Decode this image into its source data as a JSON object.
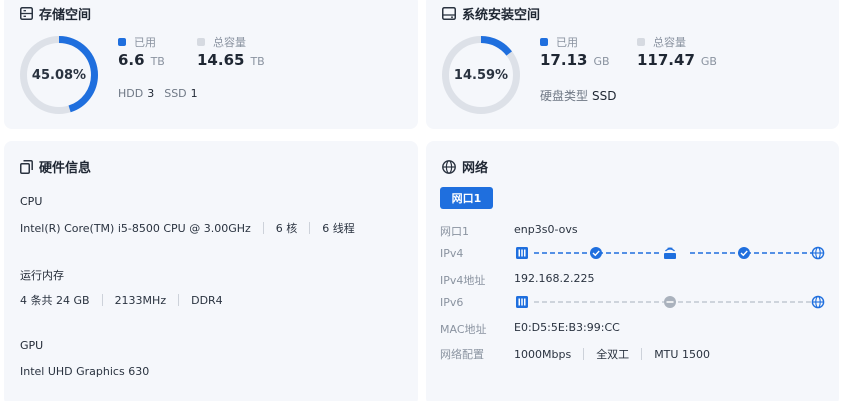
{
  "storage": {
    "title": "存储空间",
    "percent": "45.08%",
    "ratio": 0.4508,
    "used_label": "已用",
    "used_value": "6.6",
    "used_unit": "TB",
    "total_label": "总容量",
    "total_value": "14.65",
    "total_unit": "TB",
    "hdd_label": "HDD",
    "hdd_value": "3",
    "ssd_label": "SSD",
    "ssd_value": "1"
  },
  "system": {
    "title": "系统安装空间",
    "percent": "14.59%",
    "ratio": 0.1459,
    "used_label": "已用",
    "used_value": "17.13",
    "used_unit": "GB",
    "total_label": "总容量",
    "total_value": "117.47",
    "total_unit": "GB",
    "disk_type_label": "硬盘类型",
    "disk_type_value": "SSD"
  },
  "hardware": {
    "title": "硬件信息",
    "cpu_label": "CPU",
    "cpu_model": "Intel(R) Core(TM) i5-8500 CPU @ 3.00GHz",
    "cpu_cores": "6 核",
    "cpu_threads": "6 线程",
    "mem_label": "运行内存",
    "mem_size": "4 条共 24 GB",
    "mem_speed": "2133MHz",
    "mem_type": "DDR4",
    "gpu_label": "GPU",
    "gpu_model": "Intel UHD Graphics 630"
  },
  "network": {
    "title": "网络",
    "tab_label": "网口1",
    "port_label": "网口1",
    "port_value": "enp3s0-ovs",
    "ipv4_label": "IPv4",
    "ipv4_addr_label": "IPv4地址",
    "ipv4_addr_value": "192.168.2.225",
    "ipv6_label": "IPv6",
    "mac_label": "MAC地址",
    "mac_value": "E0:D5:5E:B3:99:CC",
    "config_label": "网络配置",
    "config_speed": "1000Mbps",
    "config_duplex": "全双工",
    "config_mtu": "MTU 1500"
  },
  "colors": {
    "accent": "#1f6fde",
    "ring_track": "#dde1e8",
    "legend_total": "#d6dae1",
    "card_bg": "#f5f7fb",
    "ipv6_gray": "#aab2bd"
  },
  "icons": {
    "storage": "storage-icon",
    "system": "drive-icon",
    "hardware": "hardware-icon",
    "network": "globe-icon"
  }
}
